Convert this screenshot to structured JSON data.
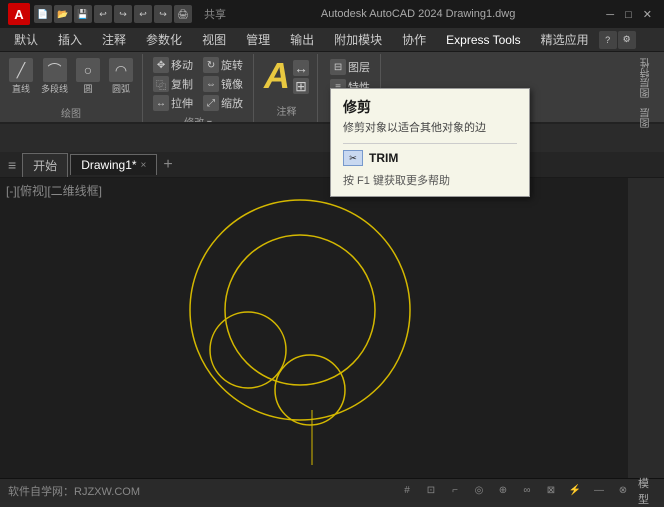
{
  "app": {
    "logo": "A",
    "title": "Autodesk AutoCAD 2024",
    "filename": "Drawing1.dwg",
    "title_full": "Autodesk AutoCAD 2024    Drawing1.dwg"
  },
  "titlebar": {
    "share_label": "共享",
    "quick_icons": [
      "new",
      "open",
      "save",
      "undo",
      "redo",
      "print",
      "share"
    ]
  },
  "menubar": {
    "items": [
      "默认",
      "插入",
      "注释",
      "参数化",
      "视图",
      "管理",
      "输出",
      "附加模块",
      "协作",
      "Express Tools",
      "精选应用"
    ]
  },
  "ribbon": {
    "groups": [
      {
        "name": "绘图",
        "buttons": [
          "直线",
          "多段线",
          "圆",
          "圆弧"
        ]
      },
      {
        "name": "修改",
        "small_buttons": [
          "移动",
          "旋转",
          "复制",
          "镜像",
          "拉伸",
          "缩放"
        ]
      }
    ],
    "modify_label": "修改",
    "draw_label": "绘图"
  },
  "right_panel": {
    "labels": [
      "图层特性",
      "图层"
    ]
  },
  "tabs": {
    "hamburger": "≡",
    "home_tab": "开始",
    "drawing_tab": "Drawing1*",
    "close_symbol": "×",
    "add_symbol": "+"
  },
  "canvas": {
    "view_label": "[-][俯视][二维线框]"
  },
  "tooltip": {
    "title": "修剪",
    "description": "修剪对象以适合其他对象的边",
    "command_label": "TRIM",
    "command_icon": "✂",
    "help_text": "按 F1 键获取更多帮助"
  },
  "statusbar": {
    "website": "软件自学网：RJZXW.COM",
    "icons": [
      "grid",
      "snap",
      "ortho",
      "polar",
      "osnap",
      "otrack",
      "ducs",
      "dyn",
      "lw",
      "tp",
      "model"
    ]
  }
}
